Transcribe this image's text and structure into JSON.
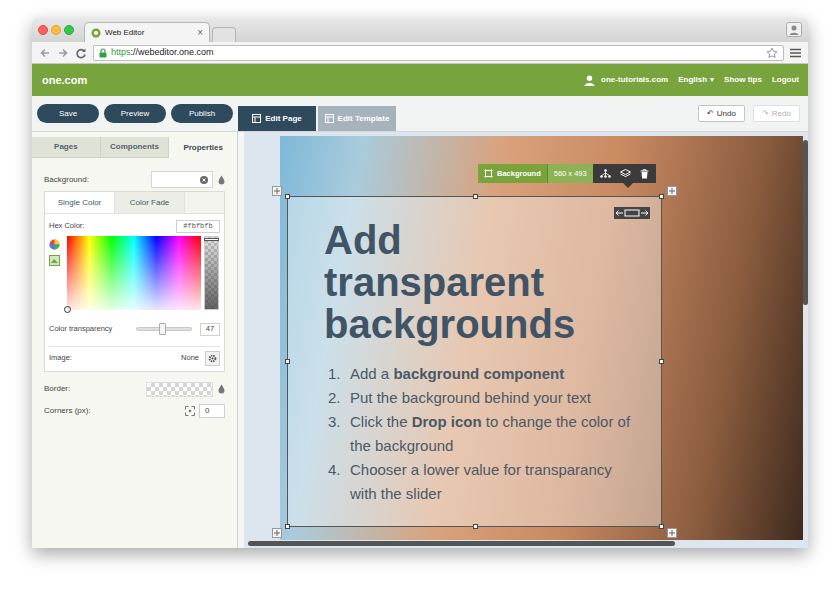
{
  "browser": {
    "tab_title": "Web Editor",
    "tab_close": "×",
    "url_scheme": "https",
    "url_rest": "://webeditor.one.com"
  },
  "header": {
    "logo": "one.com",
    "account": "one-tutorials.com",
    "language": "English",
    "language_caret": "▾",
    "links": [
      "Show tips",
      "Logout"
    ]
  },
  "actions": [
    "Save",
    "Preview",
    "Publish"
  ],
  "mode_tabs": [
    {
      "label": "Edit Page",
      "selected": true
    },
    {
      "label": "Edit Template",
      "selected": false
    }
  ],
  "history": [
    {
      "icon": "↶",
      "label": "Undo",
      "disabled": false
    },
    {
      "icon": "↷",
      "label": "Redo",
      "disabled": true
    }
  ],
  "panel": {
    "tabs": [
      {
        "label": "Pages",
        "selected": false
      },
      {
        "label": "Components",
        "selected": false
      },
      {
        "label": "Properties",
        "selected": true
      }
    ],
    "background_label": "Background:",
    "fill_tabs": [
      {
        "label": "Single Color",
        "selected": true
      },
      {
        "label": "Color Fade",
        "selected": false
      }
    ],
    "hex_label": "Hex Color:",
    "hex_value": "#fbfbfb",
    "transparency_label": "Color transparency",
    "transparency_level": 0.47,
    "transparency_value": "47",
    "image_label": "Image:",
    "image_value": "None",
    "border_label": "Border:",
    "corners_label": "Corners (px):",
    "corners_value": "0"
  },
  "canvas": {
    "component_label": "Background",
    "component_size": "560 x 493",
    "heading": "Add transparent backgrounds",
    "steps": [
      {
        "number": "1.",
        "parts": [
          {
            "text": "Add a ",
            "bold": false
          },
          {
            "text": "background component",
            "bold": true
          }
        ]
      },
      {
        "number": "2.",
        "parts": [
          {
            "text": "Put the background behind your text",
            "bold": false
          }
        ]
      },
      {
        "number": "3.",
        "parts": [
          {
            "text": "Click the ",
            "bold": false
          },
          {
            "text": "Drop icon",
            "bold": true
          },
          {
            "text": " to change the color of the background",
            "bold": false
          }
        ]
      },
      {
        "number": "4.",
        "parts": [
          {
            "text": "Chooser a lower value for transparancy with the slider",
            "bold": false
          }
        ]
      }
    ]
  }
}
